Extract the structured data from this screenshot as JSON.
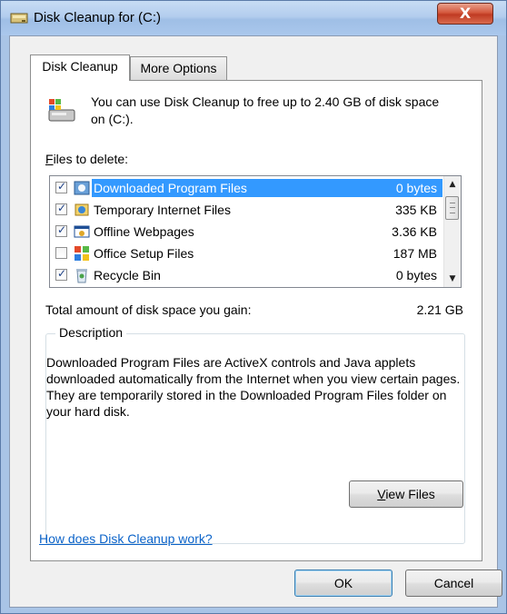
{
  "window": {
    "title": "Disk Cleanup for  (C:)",
    "close_label": "X"
  },
  "tabs": [
    {
      "label": "Disk Cleanup",
      "active": true
    },
    {
      "label": "More Options",
      "active": false
    }
  ],
  "intro": {
    "icon": "disk-cleanup-icon",
    "text": "You can use Disk Cleanup to free up to 2.40 GB of disk space on  (C:)."
  },
  "files": {
    "label_prefix": "",
    "label_mnemonic": "F",
    "label_rest": "iles to delete:",
    "items": [
      {
        "name": "Downloaded Program Files",
        "size": "0 bytes",
        "checked": true,
        "selected": true,
        "icon": "downloaded-program-files-icon"
      },
      {
        "name": "Temporary Internet Files",
        "size": "335 KB",
        "checked": true,
        "selected": false,
        "icon": "temporary-internet-files-icon"
      },
      {
        "name": "Offline Webpages",
        "size": "3.36 KB",
        "checked": true,
        "selected": false,
        "icon": "offline-webpages-icon"
      },
      {
        "name": "Office Setup Files",
        "size": "187 MB",
        "checked": false,
        "selected": false,
        "icon": "office-setup-files-icon"
      },
      {
        "name": "Recycle Bin",
        "size": "0 bytes",
        "checked": true,
        "selected": false,
        "icon": "recycle-bin-icon"
      }
    ]
  },
  "total": {
    "label": "Total amount of disk space you gain:",
    "value": "2.21 GB"
  },
  "description": {
    "title": "Description",
    "text": "Downloaded Program Files are ActiveX controls and Java applets downloaded automatically from the Internet when you view certain pages. They are temporarily stored in the Downloaded Program Files folder on your hard disk.",
    "view_files_mnemonic": "V",
    "view_files_rest": "iew Files"
  },
  "help_link": "How does Disk Cleanup work?",
  "buttons": {
    "ok": "OK",
    "cancel": "Cancel"
  },
  "colors": {
    "selection": "#3399ff",
    "link": "#0b63c9",
    "frame": "#a9c4e6"
  }
}
